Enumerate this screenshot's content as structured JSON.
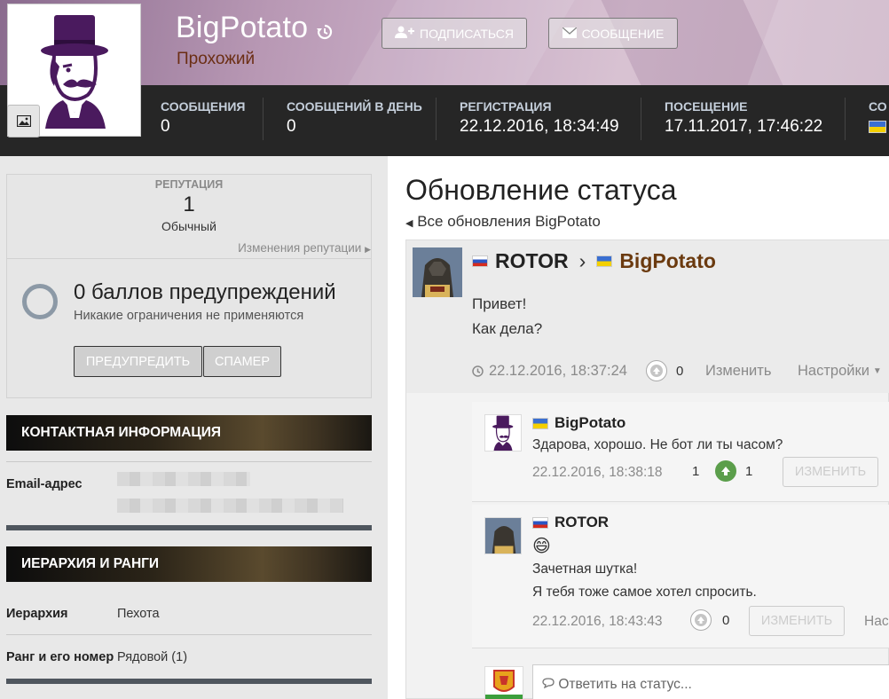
{
  "profile": {
    "username": "BigPotato",
    "rank_title": "Прохожий",
    "follow_label": "ПОДПИСАТЬСЯ",
    "message_label": "СООБЩЕНИЕ"
  },
  "stats": [
    {
      "label": "СООБЩЕНИЯ",
      "value": "0"
    },
    {
      "label": "СООБЩЕНИЙ В ДЕНЬ",
      "value": "0"
    },
    {
      "label": "РЕГИСТРАЦИЯ",
      "value": "22.12.2016, 18:34:49"
    },
    {
      "label": "ПОСЕЩЕНИЕ",
      "value": "17.11.2017, 17:46:22"
    },
    {
      "label": "СО",
      "value": ""
    }
  ],
  "reputation": {
    "label": "РЕПУТАЦИЯ",
    "value": "1",
    "rank": "Обычный",
    "changes_link": "Изменения репутации"
  },
  "warnings": {
    "title": "0 баллов предупреждений",
    "subtitle": "Никакие ограничения не применяются",
    "warn_button": "ПРЕДУПРЕДИТЬ",
    "spammer_button": "СПАМЕР"
  },
  "contact": {
    "heading": "КОНТАКТНАЯ ИНФОРМАЦИЯ",
    "email_label": "Email-адрес"
  },
  "hierarchy": {
    "heading": "ИЕРАРХИЯ И РАНГИ",
    "rows": [
      {
        "key": "Иерархия",
        "value": "Пехота"
      },
      {
        "key": "Ранг и его номер",
        "value": "Рядовой (1)"
      }
    ]
  },
  "main": {
    "title": "Обновление статуса",
    "back_link": "Все обновления BigPotato",
    "status": {
      "from": "ROTOR",
      "to": "BigPotato",
      "lines": [
        "Привет!",
        "Как дела?"
      ],
      "time": "22.12.2016, 18:37:24",
      "votes": "0",
      "edit": "Изменить",
      "settings": "Настройки"
    },
    "comments": [
      {
        "author": "BigPotato",
        "text": "Здарова, хорошо. Не бот ли ты часом?",
        "time": "22.12.2016, 18:38:18",
        "likes_left": "1",
        "votes": "1",
        "edit": "ИЗМЕНИТЬ"
      },
      {
        "author": "ROTOR",
        "emoji": "😄",
        "lines": [
          "Зачетная шутка!",
          "Я тебя тоже самое хотел спросить."
        ],
        "time": "22.12.2016, 18:43:43",
        "votes": "0",
        "edit": "ИЗМЕНИТЬ",
        "more": "Нас"
      }
    ],
    "reply_placeholder": "Ответить на статус..."
  },
  "colors": {
    "stats_bar": "#262626",
    "rank_title": "#6b2e14",
    "to_user": "#6b3a0f",
    "upvote_green": "#5b9e4b"
  }
}
